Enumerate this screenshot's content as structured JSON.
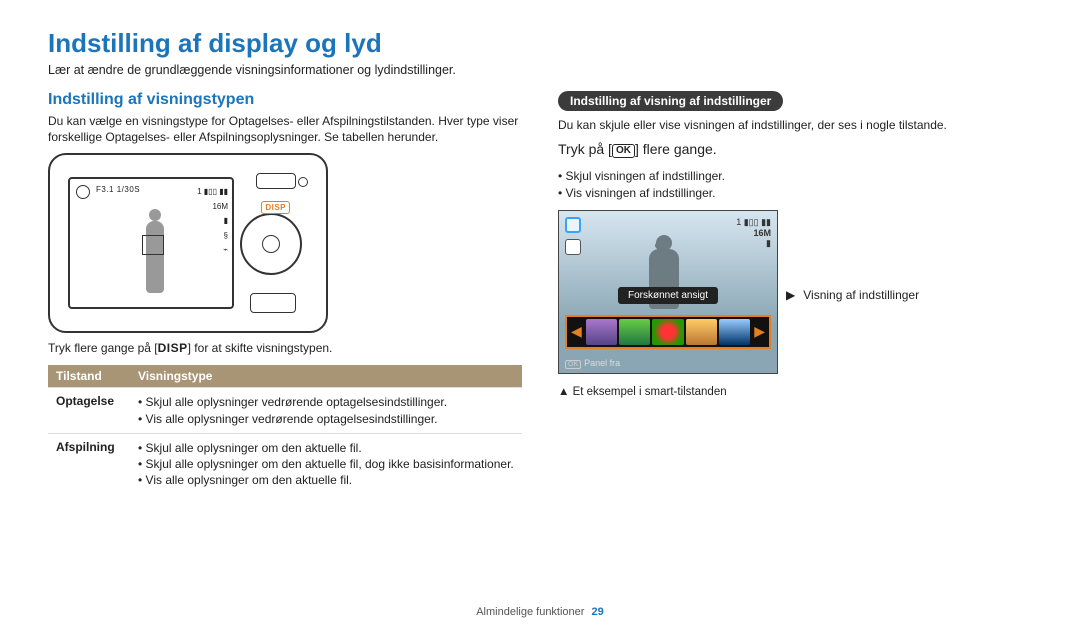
{
  "title": "Indstilling af display og lyd",
  "lead": "Lær at ændre de grundlæggende visningsinformationer og lydindstillinger.",
  "left": {
    "heading": "Indstilling af visningstypen",
    "para": "Du kan vælge en visningstype for Optagelses- eller Afspilningstilstanden. Hver type viser forskellige Optagelses- eller Afspilningsoplysninger. Se tabellen herunder.",
    "camera": {
      "exposure": "F3.1 1/30S",
      "right_stack": "1 ▮▯▯ ▮▮\n16M\n▮\n§\n⌁",
      "disp_btn": "DISP"
    },
    "instr_pre": "Tryk flere gange på [",
    "instr_key": "DISP",
    "instr_post": "] for at skifte visningstypen.",
    "table": {
      "head_mode": "Tilstand",
      "head_type": "Visningstype",
      "rows": [
        {
          "mode": "Optagelse",
          "items": [
            "Skjul alle oplysninger vedrørende optagelsesindstillinger.",
            "Vis alle oplysninger vedrørende optagelsesindstillinger."
          ]
        },
        {
          "mode": "Afspilning",
          "items": [
            "Skjul alle oplysninger om den aktuelle fil.",
            "Skjul alle oplysninger om den aktuelle fil, dog ikke basisinformationer.",
            "Vis alle oplysninger om den aktuelle fil."
          ]
        }
      ]
    }
  },
  "right": {
    "pill": "Indstilling af visning af indstillinger",
    "para": "Du kan skjule eller vise visningen af indstillinger, der ses i nogle tilstande.",
    "press_pre": "Tryk på [",
    "press_key": "OK",
    "press_post": "] flere gange.",
    "bullets": [
      "Skjul visningen af indstillinger.",
      "Vis visningen af indstillinger."
    ],
    "shot": {
      "top_right_line1": "1  ▮▯▯  ▮▮",
      "top_right_size": "16M",
      "tooltip": "Forskønnet ansigt",
      "panel_off_key": "OK",
      "panel_off_label": "Panel fra"
    },
    "callout": "Visning af indstillinger",
    "footnote": "Et eksempel i smart-tilstanden"
  },
  "footer": {
    "section": "Almindelige funktioner",
    "page": "29"
  }
}
